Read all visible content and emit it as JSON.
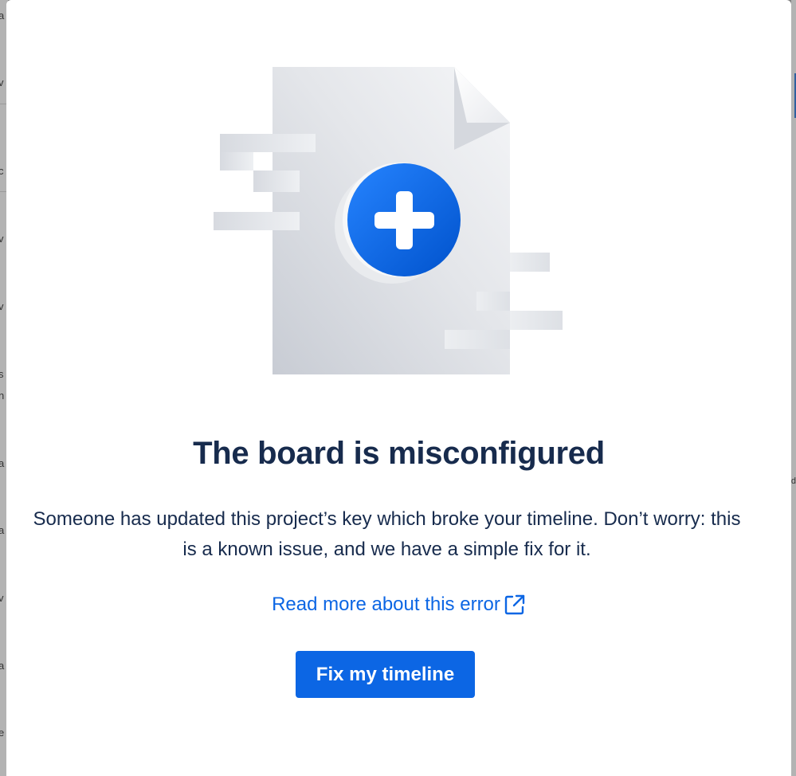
{
  "background": {
    "left_fragments": [
      "a",
      "v",
      "c",
      "v",
      "v",
      "s",
      "n",
      "a",
      "a",
      "v",
      "a",
      "e"
    ],
    "right_fragments": [
      "d"
    ]
  },
  "dialog": {
    "title": "The board is misconfigured",
    "description": "Someone has updated this project’s key which broke your timeline. Don’t worry: this is a known issue, and we have a simple fix for it.",
    "help_link_label": "Read more about this error",
    "fix_button_label": "Fix my timeline",
    "illustration_icon": "document-plus-icon",
    "link_icon": "external-link-icon"
  },
  "colors": {
    "primary": "#0c66e4",
    "text": "#172b4d",
    "link": "#0c66e4"
  }
}
